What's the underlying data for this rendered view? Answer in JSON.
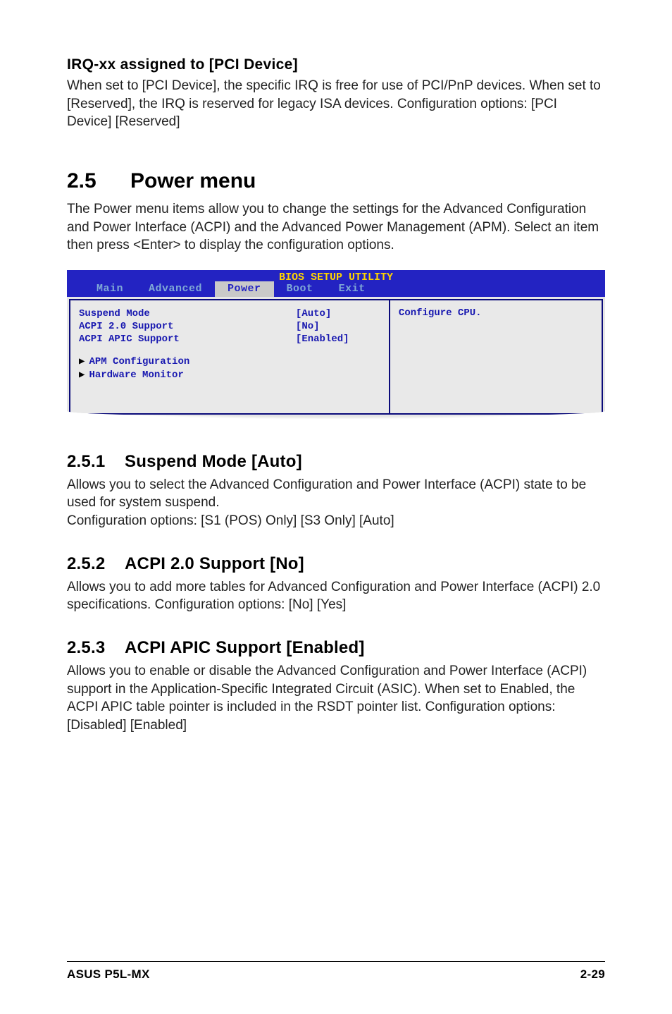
{
  "irq": {
    "heading": "IRQ-xx assigned to [PCI Device]",
    "body": "When set to [PCI Device], the specific IRQ is free for use of PCI/PnP devices. When set to [Reserved], the IRQ is reserved for legacy ISA devices. Configuration options: [PCI Device] [Reserved]"
  },
  "section": {
    "num": "2.5",
    "title": "Power menu",
    "body": "The Power menu items allow you to change the settings for the Advanced Configuration and Power Interface (ACPI) and the Advanced Power Management (APM). Select an item then press <Enter> to display the configuration options."
  },
  "bios": {
    "title": "BIOS SETUP UTILITY",
    "tabs": [
      "Main",
      "Advanced",
      "Power",
      "Boot",
      "Exit"
    ],
    "active_tab": "Power",
    "rows": [
      {
        "label": "Suspend Mode",
        "value": "[Auto]"
      },
      {
        "label": "ACPI 2.0 Support",
        "value": "[No]"
      },
      {
        "label": "ACPI APIC Support",
        "value": "[Enabled]"
      }
    ],
    "subitems": [
      "APM Configuration",
      "Hardware Monitor"
    ],
    "help": "Configure CPU."
  },
  "s251": {
    "num": "2.5.1",
    "title": "Suspend Mode [Auto]",
    "body1": "Allows you to select the Advanced Configuration and Power Interface (ACPI) state to be used for system suspend.",
    "body2": "Configuration options: [S1 (POS) Only] [S3 Only] [Auto]"
  },
  "s252": {
    "num": "2.5.2",
    "title": "ACPI 2.0 Support [No]",
    "body": "Allows you to add more tables for Advanced Configuration and Power Interface (ACPI) 2.0 specifications. Configuration options: [No] [Yes]"
  },
  "s253": {
    "num": "2.5.3",
    "title": "ACPI APIC Support [Enabled]",
    "body": "Allows you to enable or disable the Advanced Configuration and Power Interface (ACPI) support in the Application-Specific Integrated Circuit (ASIC). When set to Enabled, the ACPI APIC table pointer is included in the RSDT pointer list. Configuration options: [Disabled] [Enabled]"
  },
  "footer": {
    "left": "ASUS P5L-MX",
    "right": "2-29"
  }
}
